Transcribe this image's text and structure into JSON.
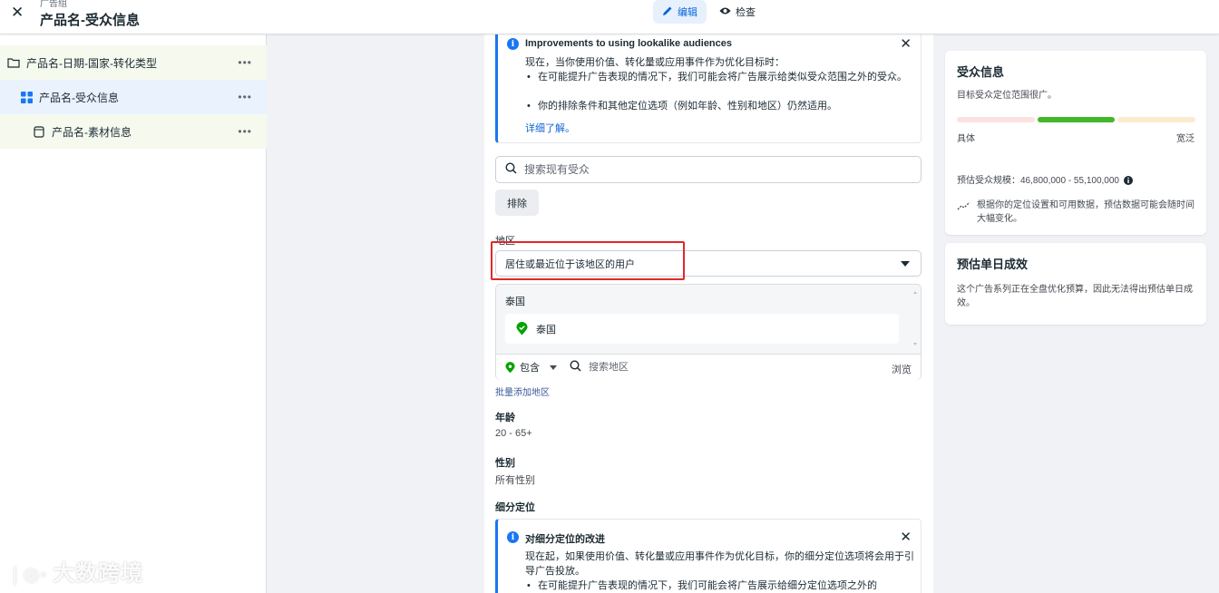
{
  "header": {
    "breadcrumb_small": "广告组",
    "title": "产品名-受众信息",
    "tab_edit": "编辑",
    "tab_review": "检查"
  },
  "sidebar": {
    "items": [
      {
        "label": "产品名-日期-国家-转化类型",
        "more": "•••"
      },
      {
        "label": "产品名-受众信息",
        "more": "•••"
      },
      {
        "label": "产品名-素材信息",
        "more": "•••"
      }
    ]
  },
  "notice1": {
    "title": "Improvements to using lookalike audiences",
    "intro": "现在，当你使用价值、转化量或应用事件作为优化目标时：",
    "bullet1": "在可能提升广告表现的情况下，我们可能会将广告展示给类似受众范围之外的受众。",
    "bullet2": "你的排除条件和其他定位选项（例如年龄、性别和地区）仍然适用。",
    "link": "详细了解。"
  },
  "audience_search": {
    "placeholder": "搜索现有受众"
  },
  "exclude_label": "排除",
  "location": {
    "section_label": "地区",
    "select_value": "居住或最近位于该地区的用户",
    "group_label": "泰国",
    "chip_label": "泰国",
    "include_label": "包含",
    "search_placeholder": "搜索地区",
    "browse": "浏览",
    "bulk_add": "批量添加地区"
  },
  "age": {
    "label": "年龄",
    "value": "20 - 65+"
  },
  "gender": {
    "label": "性别",
    "value": "所有性别"
  },
  "detailed": {
    "label": "细分定位"
  },
  "notice2": {
    "title": "对细分定位的改进",
    "intro": "现在起，如果使用价值、转化量或应用事件作为优化目标，你的细分定位选项将会用于引导广告投放。",
    "bullet1": "在可能提升广告表现的情况下，我们可能会将广告展示给细分定位选项之外的"
  },
  "audience_card": {
    "title": "受众信息",
    "subtitle": "目标受众定位范围很广。",
    "specific": "具体",
    "broad": "宽泛",
    "size_label": "预估受众规模：46,800,000 - 55,100,000",
    "note": "根据你的定位设置和可用数据，预估数据可能会随时间大幅变化。",
    "meter_level": "broad-middle",
    "colors": {
      "meter_left": "#fbe2e0",
      "meter_mid": "#42b72a",
      "meter_right": "#fdebd0"
    }
  },
  "results_card": {
    "title": "预估单日成效",
    "text": "这个广告系列正在全盘优化预算，因此无法得出预估单日成效。"
  },
  "watermark": "大数跨境",
  "accent_color": "#1877f2",
  "highlight_color": "#e0292a"
}
